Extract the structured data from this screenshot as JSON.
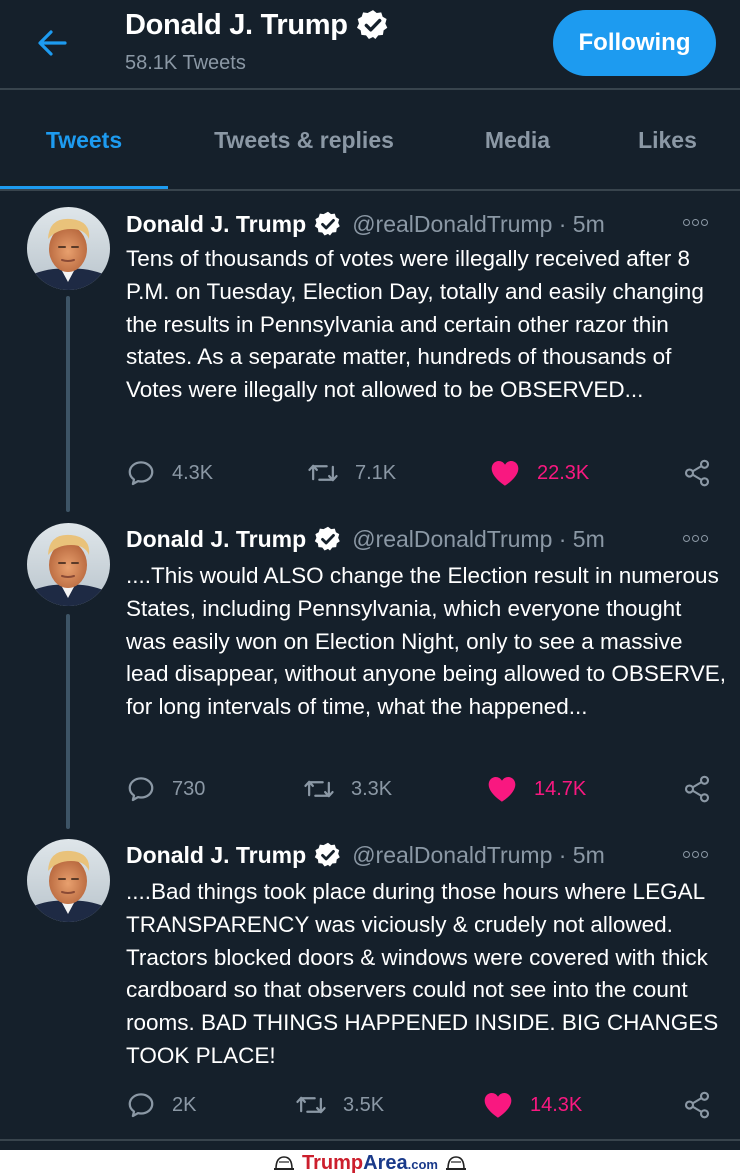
{
  "header": {
    "name": "Donald J. Trump",
    "tweet_count": "58.1K Tweets",
    "follow_label": "Following"
  },
  "tabs": [
    {
      "label": "Tweets",
      "active": true
    },
    {
      "label": "Tweets & replies"
    },
    {
      "label": "Media"
    },
    {
      "label": "Likes"
    }
  ],
  "tweets": [
    {
      "name": "Donald J. Trump",
      "handle": "@realDonaldTrump · 5m",
      "text": "Tens of thousands of votes were illegally received after 8 P.M. on Tuesday, Election Day, totally and easily changing the results in Pennsylvania and certain other razor thin states. As a separate matter, hundreds of thousands of Votes were illegally not allowed to be OBSERVED...",
      "replies": "4.3K",
      "retweets": "7.1K",
      "likes": "22.3K"
    },
    {
      "name": "Donald J. Trump",
      "handle": "@realDonaldTrump · 5m",
      "text": "....This would ALSO change the Election result in numerous States, including Pennsylvania, which everyone thought was easily won on Election Night, only to see a massive lead disappear, without anyone being allowed to OBSERVE, for long intervals of time, what the happened...",
      "replies": "730",
      "retweets": "3.3K",
      "likes": "14.7K"
    },
    {
      "name": "Donald J. Trump",
      "handle": "@realDonaldTrump · 5m",
      "text": "....Bad things took place during those hours where LEGAL TRANSPARENCY was viciously & crudely not allowed. Tractors blocked doors & windows were covered with thick cardboard so that observers could not see into the count rooms. BAD THINGS HAPPENED INSIDE. BIG CHANGES TOOK PLACE!",
      "replies": "2K",
      "retweets": "3.5K",
      "likes": "14.3K"
    }
  ],
  "footer": {
    "brand_red": "Trump",
    "brand_blue": "Area",
    "brand_suffix": ".com"
  },
  "colors": {
    "background": "#15202b",
    "accent": "#1d9bf0",
    "like": "#f91880",
    "muted": "#8b98a5",
    "divider": "#38444d"
  }
}
